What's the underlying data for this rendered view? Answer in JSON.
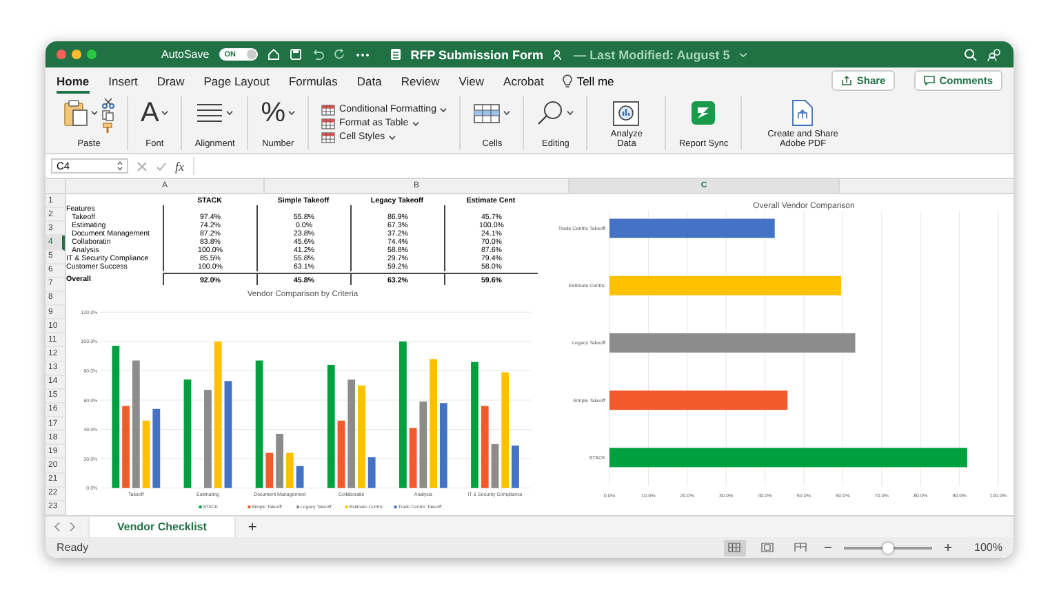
{
  "window": {
    "title": "RFP Submission Form",
    "subtitle": "— Last Modified: August 5"
  },
  "autosave": {
    "label": "AutoSave",
    "toggle_text": "ON",
    "on": true
  },
  "tabs": [
    {
      "label": "Home",
      "selected": true
    },
    {
      "label": "Insert",
      "selected": false
    },
    {
      "label": "Draw",
      "selected": false
    },
    {
      "label": "Page Layout",
      "selected": false
    },
    {
      "label": "Formulas",
      "selected": false
    },
    {
      "label": "Data",
      "selected": false
    },
    {
      "label": "Review",
      "selected": false
    },
    {
      "label": "View",
      "selected": false
    },
    {
      "label": "Acrobat",
      "selected": false
    }
  ],
  "tell_me": "Tell me",
  "share_button": "Share",
  "comments_button": "Comments",
  "ribbon": [
    {
      "kind": "paste",
      "label": "Paste"
    },
    {
      "kind": "glyph",
      "glyph": "A",
      "label": "Font"
    },
    {
      "kind": "alignment",
      "label": "Alignment"
    },
    {
      "kind": "glyph",
      "glyph": "%",
      "label": "Number"
    },
    {
      "kind": "styles",
      "items": [
        "Conditional Formatting",
        "Format as Table",
        "Cell Styles"
      ]
    },
    {
      "kind": "cells",
      "label": "Cells"
    },
    {
      "kind": "editing",
      "label": "Editing"
    },
    {
      "kind": "analyze",
      "label": "Analyze Data"
    },
    {
      "kind": "addin",
      "label": "Report Sync"
    },
    {
      "kind": "pdf",
      "label": "Create and Share Adobe PDF"
    }
  ],
  "formula_bar": {
    "cell": "C4",
    "function_label": "fx"
  },
  "column_headers": [
    {
      "label": "A",
      "selected": false
    },
    {
      "label": "B",
      "selected": false
    },
    {
      "label": "C",
      "selected": true
    }
  ],
  "row_headers": [
    {
      "label": "1",
      "selected": false
    },
    {
      "label": "2",
      "selected": false
    },
    {
      "label": "3",
      "selected": false
    },
    {
      "label": "4",
      "selected": true
    },
    {
      "label": "5",
      "selected": false
    },
    {
      "label": "6",
      "selected": false
    },
    {
      "label": "7",
      "selected": false
    },
    {
      "label": "8",
      "selected": false
    },
    {
      "label": "9",
      "selected": false
    },
    {
      "label": "10",
      "selected": false
    },
    {
      "label": "11",
      "selected": false
    },
    {
      "label": "12",
      "selected": false
    },
    {
      "label": "13",
      "selected": false
    },
    {
      "label": "14",
      "selected": false
    },
    {
      "label": "15",
      "selected": false
    },
    {
      "label": "16",
      "selected": false
    },
    {
      "label": "17",
      "selected": false
    },
    {
      "label": "18",
      "selected": false
    },
    {
      "label": "19",
      "selected": false
    },
    {
      "label": "20",
      "selected": false
    },
    {
      "label": "21",
      "selected": false
    },
    {
      "label": "22",
      "selected": false
    },
    {
      "label": "23",
      "selected": false
    }
  ],
  "table": {
    "columns": [
      "STACK",
      "Simple Takeoff",
      "Legacy Takeoff",
      "Estimate Cent"
    ],
    "rows": [
      {
        "label": "Features",
        "children": [
          {
            "label": "Takeoff",
            "values": [
              "97.4%",
              "55.8%",
              "86.9%",
              "45.7%"
            ]
          },
          {
            "label": "Estimating",
            "values": [
              "74.2%",
              "0.0%",
              "67.3%",
              "100.0%"
            ]
          },
          {
            "label": "Document Management",
            "values": [
              "87.2%",
              "23.8%",
              "37.2%",
              "24.1%"
            ]
          },
          {
            "label": "Collaboratin",
            "values": [
              "83.8%",
              "45.6%",
              "74.4%",
              "70.0%"
            ]
          },
          {
            "label": "Analysis",
            "values": [
              "100.0%",
              "41.2%",
              "58.8%",
              "87.6%"
            ]
          }
        ]
      },
      {
        "label": "IT & Security Compliance",
        "values": [
          "85.5%",
          "55.8%",
          "29.7%",
          "79.4%"
        ]
      },
      {
        "label": "Customer Success",
        "values": [
          "100.0%",
          "63.1%",
          "59.2%",
          "58.0%"
        ]
      },
      {
        "label": "Overall",
        "kind": "total",
        "values": [
          "92.0%",
          "45.8%",
          "63.2%",
          "59.6%"
        ]
      }
    ]
  },
  "criteria_chart": {
    "chart_data": {
      "type": "bar",
      "title": "Vendor Comparison by Criteria",
      "categories": [
        "Takeoff",
        "Estimating",
        "Document Management",
        "Collaboratin",
        "Analysis",
        "IT & Security Compliance"
      ],
      "grid": true,
      "legend": true,
      "series": [
        {
          "name": "STACK",
          "color": "#00a03e",
          "values": [
            97,
            74,
            87,
            84,
            100,
            86
          ]
        },
        {
          "name": "Simple Takeoff",
          "color": "#f15a2b",
          "values": [
            56,
            0,
            24,
            46,
            41,
            56
          ]
        },
        {
          "name": "Legacy Takeoff",
          "color": "#8c8c8c",
          "values": [
            87,
            67,
            37,
            74,
            59,
            30
          ]
        },
        {
          "name": "Estimate Centric",
          "color": "#ffc000",
          "values": [
            46,
            100,
            24,
            70,
            88,
            79
          ]
        },
        {
          "name": "Trade Centric Takeoff",
          "color": "#4472c4",
          "values": [
            54.0,
            73.0,
            15.0,
            21.0,
            58.0,
            29.0
          ]
        }
      ],
      "ylim": [
        0,
        120
      ],
      "yticks": [
        {
          "value": 0,
          "label": "0.0%"
        },
        {
          "value": 20,
          "label": "20.0%"
        },
        {
          "value": 40,
          "label": "40.0%"
        },
        {
          "value": 60,
          "label": "60.0%"
        },
        {
          "value": 80,
          "label": "80.0%"
        },
        {
          "value": 100,
          "label": "100.0%"
        },
        {
          "value": 120,
          "label": "120.0%"
        }
      ]
    }
  },
  "overall_chart": {
    "chart_data": {
      "type": "bar",
      "orientation": "horizontal",
      "grid": true,
      "title": "Overall Vendor Comparison",
      "categories": [
        "Trade Centric Takeoff",
        "Estimate Centric",
        "Legacy Takeoff",
        "Simple Takeoff",
        "STACK"
      ],
      "values": [
        42.5,
        59.6,
        63.2,
        45.8,
        92.0
      ],
      "colors": [
        "#4472c4",
        "#ffc000",
        "#8c8c8c",
        "#f15a2b",
        "#00a03e"
      ],
      "xlim": [
        0,
        100
      ],
      "xticks": [
        {
          "value": 0,
          "label": "0.0%"
        },
        {
          "value": 10,
          "label": "10.0%"
        },
        {
          "value": 20,
          "label": "20.0%"
        },
        {
          "value": 30,
          "label": "30.0%"
        },
        {
          "value": 40,
          "label": "40.0%"
        },
        {
          "value": 50,
          "label": "50.0%"
        },
        {
          "value": 60,
          "label": "60.0%"
        },
        {
          "value": 70,
          "label": "70.0%"
        },
        {
          "value": 80,
          "label": "80.0%"
        },
        {
          "value": 90,
          "label": "90.0%"
        },
        {
          "value": 100,
          "label": "100.0%"
        }
      ]
    }
  },
  "sheet_tabs": [
    {
      "label": "Vendor Checklist",
      "selected": true
    }
  ],
  "add_sheet": "+",
  "status_bar": {
    "status": "Ready",
    "zoom": "100%",
    "zoom_level": {
      "level": 0.5
    }
  }
}
